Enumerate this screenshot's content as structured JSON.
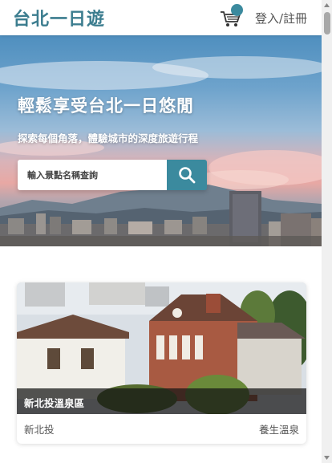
{
  "header": {
    "logo": "台北一日遊",
    "login_label": "登入/註冊",
    "cart_icon": "cart-icon"
  },
  "hero": {
    "title": "輕鬆享受台北一日悠閒",
    "subtitle": "探索每個角落，體驗城市的深度旅遊行程",
    "search": {
      "placeholder": "輸入景點名稱查詢",
      "value": "",
      "button_icon": "search-icon"
    }
  },
  "attractions": [
    {
      "name": "新北投溫泉區",
      "mrt": "新北投",
      "category": "養生溫泉"
    }
  ],
  "colors": {
    "brand": "#448899",
    "button": "#3b8a9e",
    "text_gray": "#555555"
  }
}
